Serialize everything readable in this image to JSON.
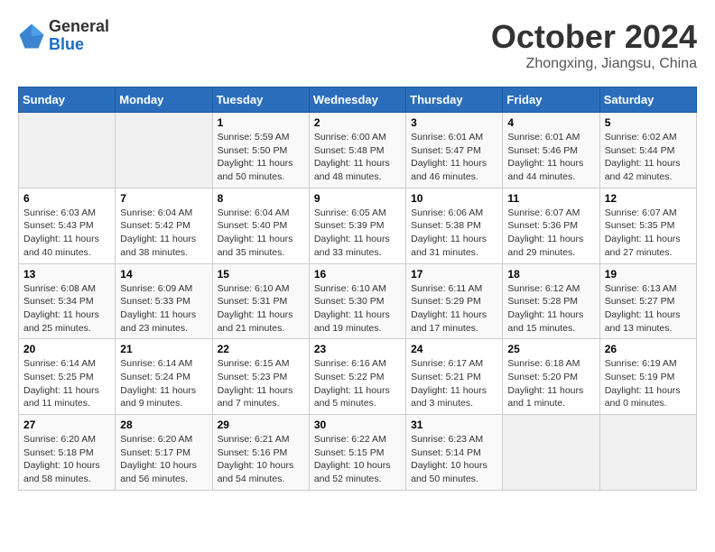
{
  "header": {
    "logo_general": "General",
    "logo_blue": "Blue",
    "month_title": "October 2024",
    "location": "Zhongxing, Jiangsu, China"
  },
  "calendar": {
    "days_of_week": [
      "Sunday",
      "Monday",
      "Tuesday",
      "Wednesday",
      "Thursday",
      "Friday",
      "Saturday"
    ],
    "weeks": [
      [
        {
          "day": "",
          "info": ""
        },
        {
          "day": "",
          "info": ""
        },
        {
          "day": "1",
          "info": "Sunrise: 5:59 AM\nSunset: 5:50 PM\nDaylight: 11 hours and 50 minutes."
        },
        {
          "day": "2",
          "info": "Sunrise: 6:00 AM\nSunset: 5:48 PM\nDaylight: 11 hours and 48 minutes."
        },
        {
          "day": "3",
          "info": "Sunrise: 6:01 AM\nSunset: 5:47 PM\nDaylight: 11 hours and 46 minutes."
        },
        {
          "day": "4",
          "info": "Sunrise: 6:01 AM\nSunset: 5:46 PM\nDaylight: 11 hours and 44 minutes."
        },
        {
          "day": "5",
          "info": "Sunrise: 6:02 AM\nSunset: 5:44 PM\nDaylight: 11 hours and 42 minutes."
        }
      ],
      [
        {
          "day": "6",
          "info": "Sunrise: 6:03 AM\nSunset: 5:43 PM\nDaylight: 11 hours and 40 minutes."
        },
        {
          "day": "7",
          "info": "Sunrise: 6:04 AM\nSunset: 5:42 PM\nDaylight: 11 hours and 38 minutes."
        },
        {
          "day": "8",
          "info": "Sunrise: 6:04 AM\nSunset: 5:40 PM\nDaylight: 11 hours and 35 minutes."
        },
        {
          "day": "9",
          "info": "Sunrise: 6:05 AM\nSunset: 5:39 PM\nDaylight: 11 hours and 33 minutes."
        },
        {
          "day": "10",
          "info": "Sunrise: 6:06 AM\nSunset: 5:38 PM\nDaylight: 11 hours and 31 minutes."
        },
        {
          "day": "11",
          "info": "Sunrise: 6:07 AM\nSunset: 5:36 PM\nDaylight: 11 hours and 29 minutes."
        },
        {
          "day": "12",
          "info": "Sunrise: 6:07 AM\nSunset: 5:35 PM\nDaylight: 11 hours and 27 minutes."
        }
      ],
      [
        {
          "day": "13",
          "info": "Sunrise: 6:08 AM\nSunset: 5:34 PM\nDaylight: 11 hours and 25 minutes."
        },
        {
          "day": "14",
          "info": "Sunrise: 6:09 AM\nSunset: 5:33 PM\nDaylight: 11 hours and 23 minutes."
        },
        {
          "day": "15",
          "info": "Sunrise: 6:10 AM\nSunset: 5:31 PM\nDaylight: 11 hours and 21 minutes."
        },
        {
          "day": "16",
          "info": "Sunrise: 6:10 AM\nSunset: 5:30 PM\nDaylight: 11 hours and 19 minutes."
        },
        {
          "day": "17",
          "info": "Sunrise: 6:11 AM\nSunset: 5:29 PM\nDaylight: 11 hours and 17 minutes."
        },
        {
          "day": "18",
          "info": "Sunrise: 6:12 AM\nSunset: 5:28 PM\nDaylight: 11 hours and 15 minutes."
        },
        {
          "day": "19",
          "info": "Sunrise: 6:13 AM\nSunset: 5:27 PM\nDaylight: 11 hours and 13 minutes."
        }
      ],
      [
        {
          "day": "20",
          "info": "Sunrise: 6:14 AM\nSunset: 5:25 PM\nDaylight: 11 hours and 11 minutes."
        },
        {
          "day": "21",
          "info": "Sunrise: 6:14 AM\nSunset: 5:24 PM\nDaylight: 11 hours and 9 minutes."
        },
        {
          "day": "22",
          "info": "Sunrise: 6:15 AM\nSunset: 5:23 PM\nDaylight: 11 hours and 7 minutes."
        },
        {
          "day": "23",
          "info": "Sunrise: 6:16 AM\nSunset: 5:22 PM\nDaylight: 11 hours and 5 minutes."
        },
        {
          "day": "24",
          "info": "Sunrise: 6:17 AM\nSunset: 5:21 PM\nDaylight: 11 hours and 3 minutes."
        },
        {
          "day": "25",
          "info": "Sunrise: 6:18 AM\nSunset: 5:20 PM\nDaylight: 11 hours and 1 minute."
        },
        {
          "day": "26",
          "info": "Sunrise: 6:19 AM\nSunset: 5:19 PM\nDaylight: 11 hours and 0 minutes."
        }
      ],
      [
        {
          "day": "27",
          "info": "Sunrise: 6:20 AM\nSunset: 5:18 PM\nDaylight: 10 hours and 58 minutes."
        },
        {
          "day": "28",
          "info": "Sunrise: 6:20 AM\nSunset: 5:17 PM\nDaylight: 10 hours and 56 minutes."
        },
        {
          "day": "29",
          "info": "Sunrise: 6:21 AM\nSunset: 5:16 PM\nDaylight: 10 hours and 54 minutes."
        },
        {
          "day": "30",
          "info": "Sunrise: 6:22 AM\nSunset: 5:15 PM\nDaylight: 10 hours and 52 minutes."
        },
        {
          "day": "31",
          "info": "Sunrise: 6:23 AM\nSunset: 5:14 PM\nDaylight: 10 hours and 50 minutes."
        },
        {
          "day": "",
          "info": ""
        },
        {
          "day": "",
          "info": ""
        }
      ]
    ]
  }
}
